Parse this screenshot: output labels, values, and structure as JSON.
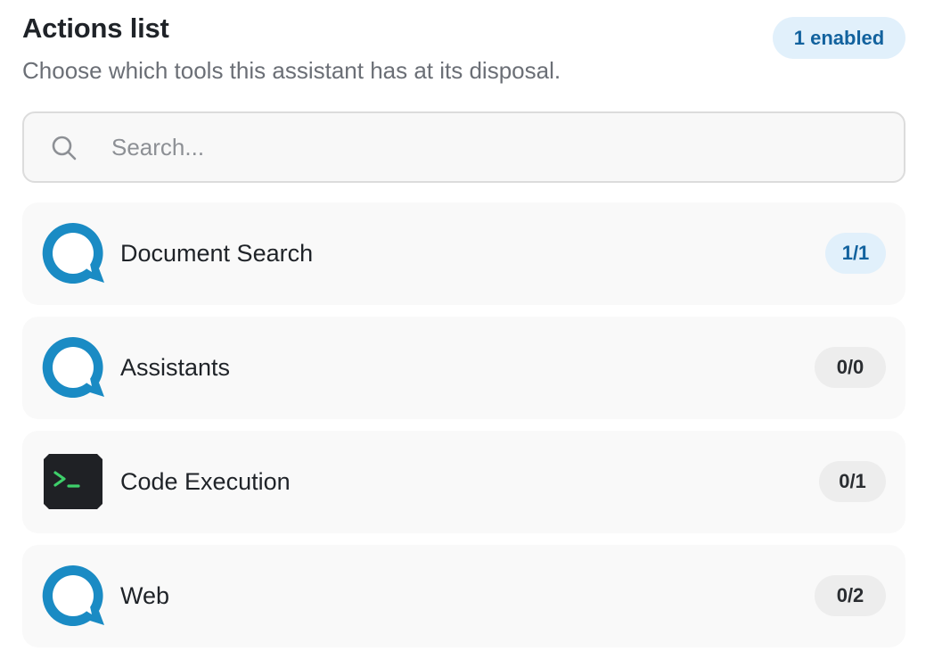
{
  "header": {
    "title": "Actions list",
    "subtitle": "Choose which tools this assistant has at its disposal.",
    "enabled_badge": "1 enabled"
  },
  "search": {
    "placeholder": "Search...",
    "value": ""
  },
  "actions": [
    {
      "label": "Document Search",
      "count": "1/1",
      "icon": "chat-bubble-icon",
      "active": true
    },
    {
      "label": "Assistants",
      "count": "0/0",
      "icon": "chat-bubble-icon",
      "active": false
    },
    {
      "label": "Code Execution",
      "count": "0/1",
      "icon": "terminal-icon",
      "active": false
    },
    {
      "label": "Web",
      "count": "0/2",
      "icon": "chat-bubble-icon",
      "active": false
    }
  ],
  "colors": {
    "accent": "#1a8bc4",
    "badge_active_bg": "#e1f0fb",
    "badge_active_text": "#12629e",
    "terminal_bg": "#1f2125",
    "terminal_prompt": "#3ecf6a"
  }
}
